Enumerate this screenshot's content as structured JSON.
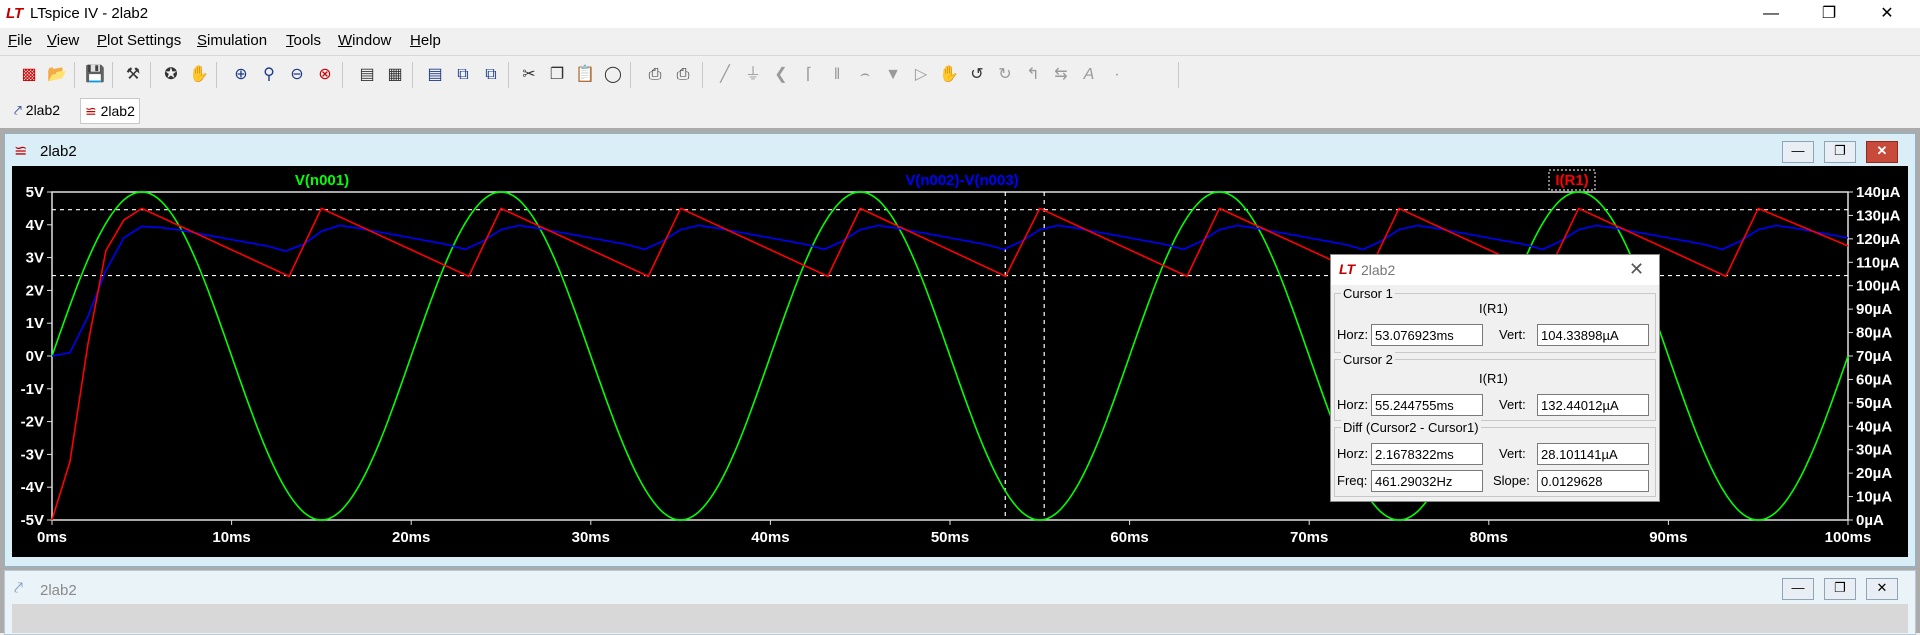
{
  "window": {
    "title": "LTspice IV - 2lab2",
    "logo": "LT"
  },
  "menu": [
    "File",
    "View",
    "Plot Settings",
    "Simulation",
    "Tools",
    "Window",
    "Help"
  ],
  "menu_underline": [
    "F",
    "V",
    "P",
    "S",
    "T",
    "W",
    "H"
  ],
  "tabs": [
    {
      "label": "2lab2",
      "icon": "schematic-icon"
    },
    {
      "label": "2lab2",
      "icon": "waveform-icon"
    }
  ],
  "plot_window": {
    "title": "2lab2"
  },
  "schematic_window": {
    "title": "2lab2"
  },
  "traces": [
    {
      "label": "V(n001)",
      "color": "#00ff00"
    },
    {
      "label": "V(n002)-V(n003)",
      "color": "#0000ff"
    },
    {
      "label": "I(R1)",
      "color": "#ff0000"
    }
  ],
  "chart_data": {
    "type": "line",
    "x_ticks": [
      "0ms",
      "10ms",
      "20ms",
      "30ms",
      "40ms",
      "50ms",
      "60ms",
      "70ms",
      "80ms",
      "90ms",
      "100ms"
    ],
    "y_left_ticks": [
      "5V",
      "4V",
      "3V",
      "2V",
      "1V",
      "0V",
      "-1V",
      "-2V",
      "-3V",
      "-4V",
      "-5V"
    ],
    "y_right_ticks": [
      "140µA",
      "130µA",
      "120µA",
      "110µA",
      "100µA",
      "90µA",
      "80µA",
      "70µA",
      "60µA",
      "50µA",
      "40µA",
      "30µA",
      "20µA",
      "10µA",
      "0µA"
    ],
    "xlim_ms": [
      0,
      100
    ],
    "ylim_left_V": [
      -5,
      5
    ],
    "ylim_right_uA": [
      0,
      140
    ],
    "grid": false,
    "series": [
      {
        "name": "V(n001)",
        "axis": "left",
        "kind": "sine",
        "amplitude_V": 5,
        "frequency_Hz": 50
      },
      {
        "name": "V(n002)-V(n003)",
        "axis": "left",
        "x": [
          0,
          1,
          2,
          3,
          4,
          5,
          6,
          7,
          8,
          9,
          10,
          11,
          12,
          13,
          14,
          15,
          16,
          17,
          18,
          19,
          20,
          21,
          22,
          23,
          24,
          25,
          26,
          27,
          28,
          29,
          30,
          31,
          32,
          33,
          34,
          35,
          36,
          37,
          38,
          39,
          40,
          41,
          42,
          43,
          44,
          45,
          46,
          47,
          48,
          49,
          50,
          51,
          52,
          53,
          54,
          55,
          56,
          57,
          58,
          59,
          60,
          61,
          62,
          63,
          64,
          65,
          66,
          67,
          68,
          69,
          70,
          71,
          72,
          73,
          74,
          75,
          76,
          77,
          78,
          79,
          80,
          81,
          82,
          83,
          84,
          85,
          86,
          87,
          88,
          89,
          90,
          91,
          92,
          93,
          94,
          95,
          96,
          97,
          98,
          99,
          100
        ],
        "y": [
          0,
          0.1,
          1.2,
          2.6,
          3.6,
          3.95,
          3.92,
          3.85,
          3.75,
          3.65,
          3.55,
          3.45,
          3.35,
          3.2,
          3.4,
          3.8,
          3.98,
          3.9,
          3.8,
          3.7,
          3.6,
          3.5,
          3.4,
          3.25,
          3.5,
          3.85,
          3.98,
          3.9,
          3.8,
          3.7,
          3.6,
          3.5,
          3.4,
          3.25,
          3.5,
          3.85,
          3.98,
          3.9,
          3.8,
          3.7,
          3.6,
          3.5,
          3.4,
          3.25,
          3.5,
          3.85,
          3.98,
          3.9,
          3.8,
          3.7,
          3.6,
          3.5,
          3.4,
          3.25,
          3.5,
          3.85,
          3.98,
          3.9,
          3.8,
          3.7,
          3.6,
          3.5,
          3.4,
          3.25,
          3.5,
          3.85,
          3.98,
          3.9,
          3.8,
          3.7,
          3.6,
          3.5,
          3.4,
          3.25,
          3.5,
          3.85,
          3.98,
          3.9,
          3.8,
          3.7,
          3.6,
          3.5,
          3.4,
          3.25,
          3.5,
          3.85,
          3.98,
          3.9,
          3.8,
          3.7,
          3.6,
          3.5,
          3.4,
          3.25,
          3.5,
          3.85,
          3.98,
          3.9,
          3.8,
          3.7,
          3.6
        ]
      },
      {
        "name": "I(R1)",
        "axis": "right",
        "x": [
          0,
          1,
          2,
          3,
          4,
          5,
          13.2,
          15,
          23.2,
          25,
          33.2,
          35,
          43.2,
          45,
          53.1,
          55,
          63.2,
          65,
          73.2,
          75,
          83.2,
          85,
          93.2,
          95,
          100
        ],
        "y": [
          0,
          25,
          75,
          115,
          128,
          133,
          104,
          133,
          104,
          133,
          104,
          133,
          104,
          133,
          104,
          133,
          104,
          133,
          104,
          133,
          104,
          133,
          104,
          133,
          117
        ]
      }
    ],
    "cursor_lines_ms": [
      53.076923,
      55.244755
    ],
    "cursor_lines_uA": [
      104.33898,
      132.44012
    ]
  },
  "cursor_dialog": {
    "title": "2lab2",
    "cursor1": {
      "group": "Cursor 1",
      "trace": "I(R1)",
      "horz_label": "Horz:",
      "horz": "53.076923ms",
      "vert_label": "Vert:",
      "vert": "104.33898µA"
    },
    "cursor2": {
      "group": "Cursor 2",
      "trace": "I(R1)",
      "horz_label": "Horz:",
      "horz": "55.244755ms",
      "vert_label": "Vert:",
      "vert": "132.44012µA"
    },
    "diff": {
      "group": "Diff (Cursor2 - Cursor1)",
      "horz_label": "Horz:",
      "horz": "2.1678322ms",
      "vert_label": "Vert:",
      "vert": "28.101141µA",
      "freq_label": "Freq:",
      "freq": "461.29032Hz",
      "slope_label": "Slope:",
      "slope": "0.0129628"
    }
  }
}
